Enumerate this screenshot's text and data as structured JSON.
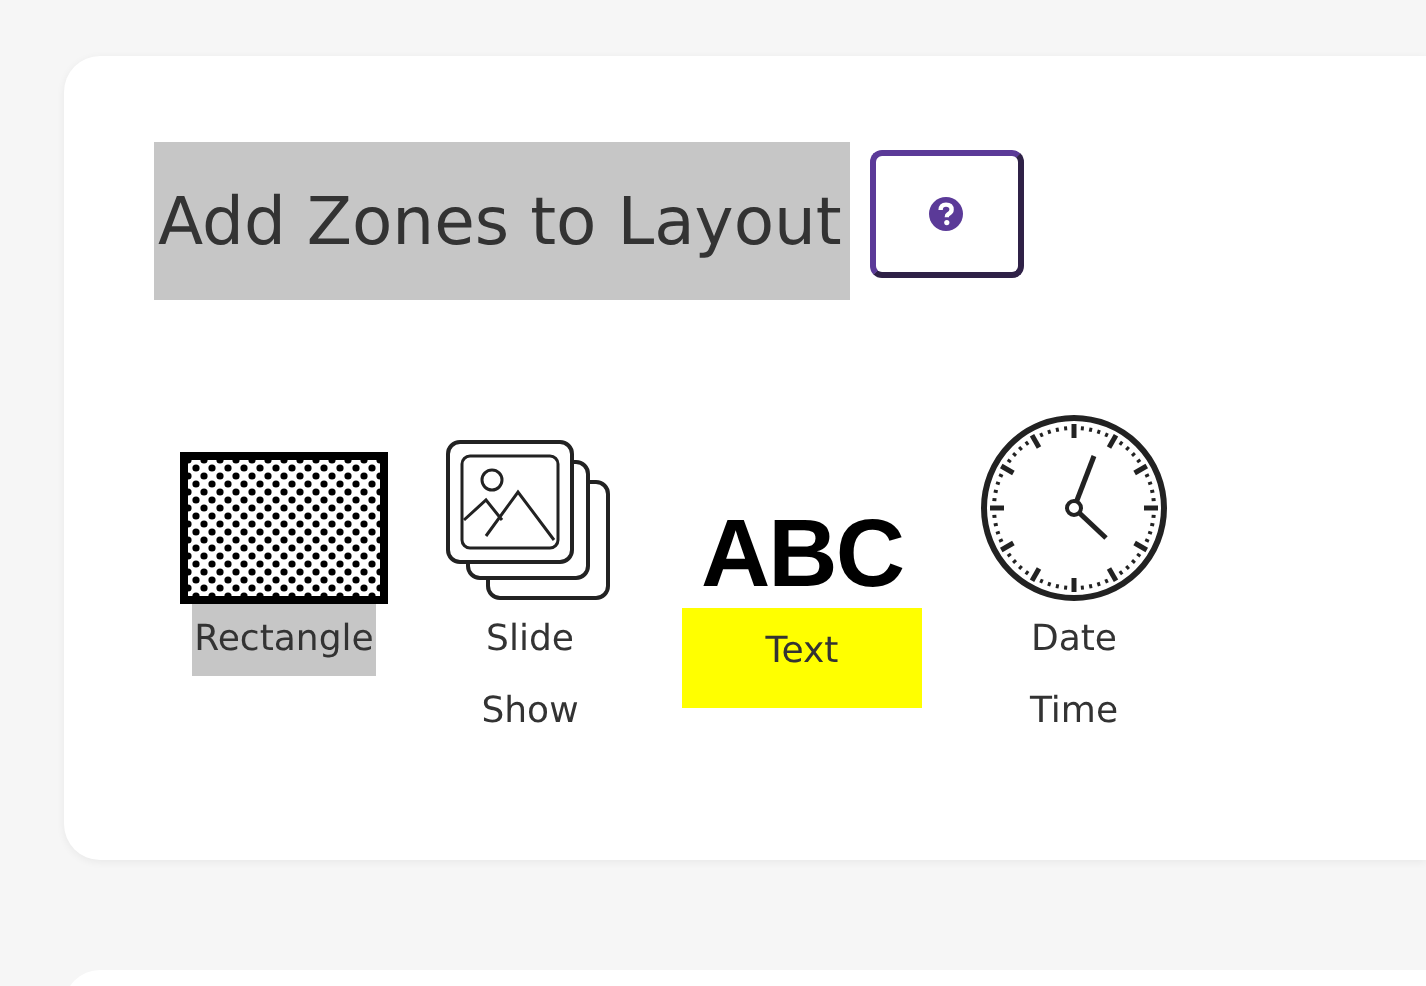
{
  "panel": {
    "title": {
      "text": "Add Zones to Layout",
      "color": "#c6c6c6"
    },
    "zones": [
      {
        "kind": "rectangle",
        "label": "Rectangle",
        "color": "#c6c6c6"
      },
      {
        "kind": "slideshow",
        "label": "Slide Show"
      },
      {
        "kind": "text",
        "icon_text": "ABC",
        "label": "Text",
        "color": "#ffff00"
      },
      {
        "kind": "clock",
        "label": "Date Time"
      }
    ]
  }
}
